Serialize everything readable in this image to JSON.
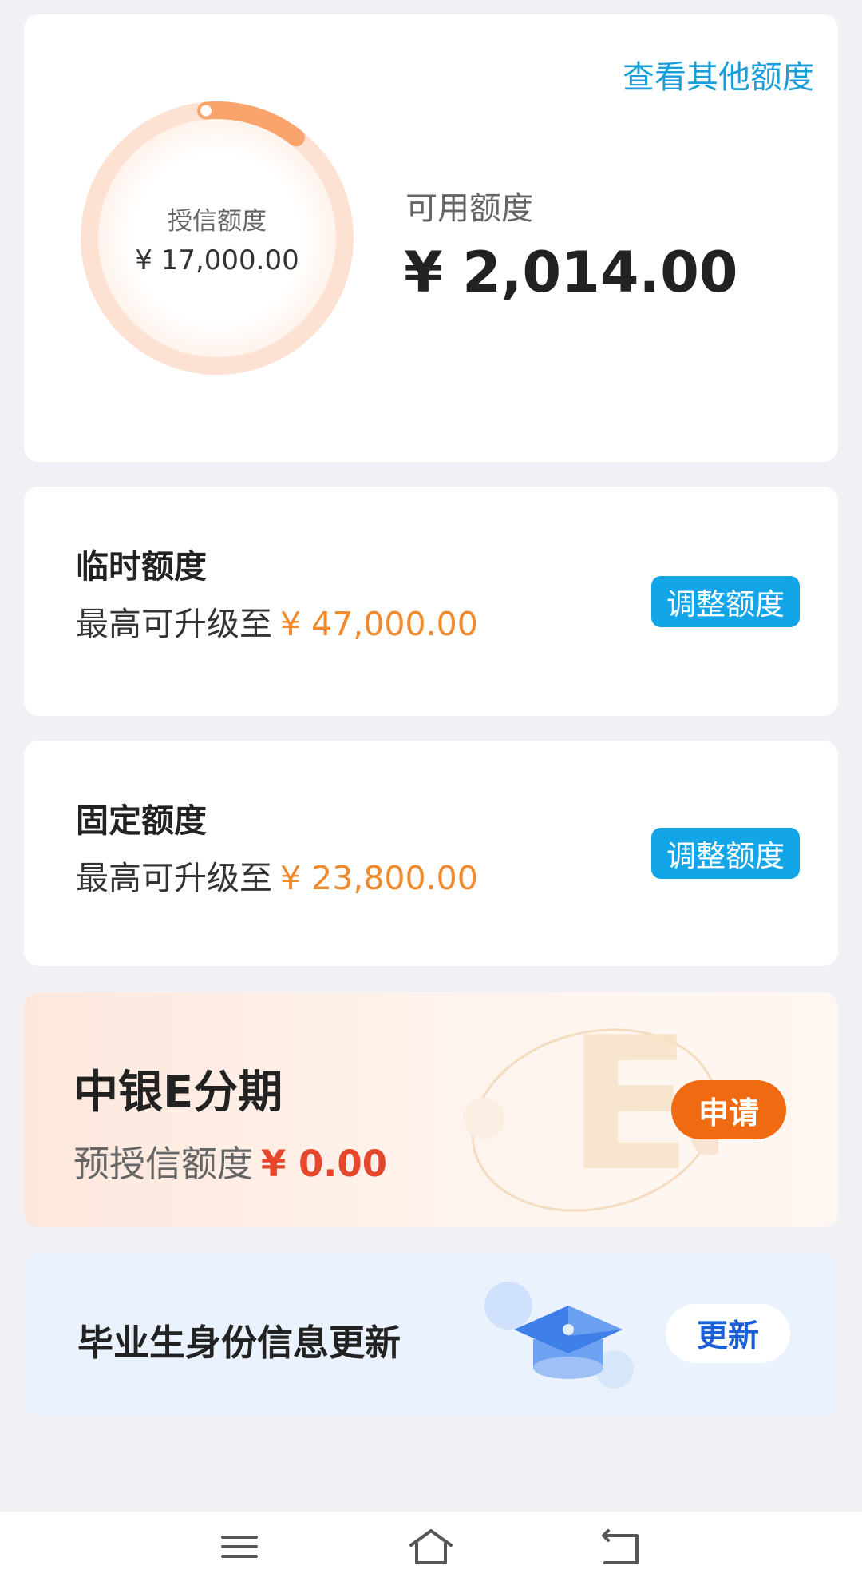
{
  "overview": {
    "other_limits_link": "查看其他额度",
    "credit_label": "授信额度",
    "credit_amount": "¥ 17,000.00",
    "credit_used_fraction": 0.12,
    "available_label": "可用额度",
    "available_amount": "¥ 2,014.00"
  },
  "temporary_limit": {
    "title": "临时额度",
    "upgrade_prefix": "最高可升级至",
    "upgrade_amount": "¥ 47,000.00",
    "button_label": "调整额度"
  },
  "fixed_limit": {
    "title": "固定额度",
    "upgrade_prefix": "最高可升级至",
    "upgrade_amount": "¥ 23,800.00",
    "button_label": "调整额度"
  },
  "installment": {
    "title": "中银E分期",
    "pre_credit_label": "预授信额度",
    "pre_credit_amount": "¥ 0.00",
    "button_label": "申请",
    "deco_letter": "E"
  },
  "graduate": {
    "title": "毕业生身份信息更新",
    "button_label": "更新"
  },
  "nav": {
    "icons": [
      "menu-icon",
      "home-icon",
      "back-icon"
    ]
  },
  "colors": {
    "accent_blue": "#12a6e8",
    "accent_orange": "#f08a2c",
    "apply_orange": "#f06a12",
    "update_blue": "#1a5fd6"
  }
}
